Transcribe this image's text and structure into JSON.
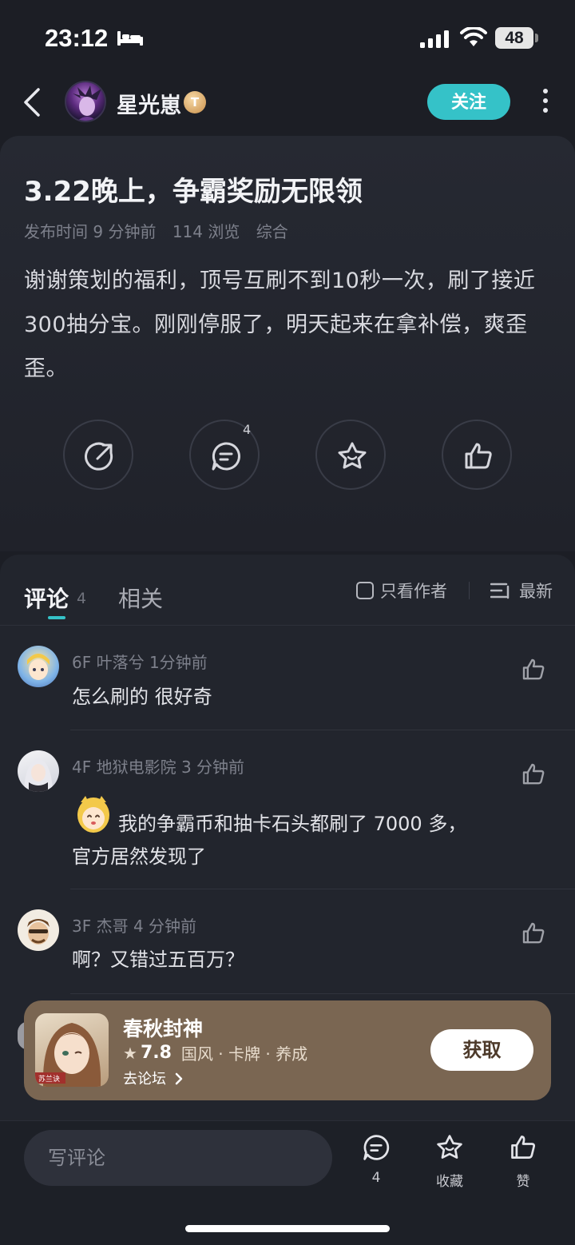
{
  "status_bar": {
    "time": "23:12",
    "battery": "48"
  },
  "header": {
    "author": "星光崽",
    "level_badge": "T",
    "follow_label": "关注"
  },
  "post": {
    "title": "3.22晚上，争霸奖励无限领",
    "meta": {
      "publish": "发布时间 9 分钟前",
      "views": "114 浏览",
      "category": "综合"
    },
    "body": "谢谢策划的福利，顶号互刷不到10秒一次，刷了接近300抽分宝。刚刚停服了，明天起来在拿补偿，爽歪歪。",
    "actions": {
      "comment_count": "4"
    }
  },
  "comments_panel": {
    "tab_comment": "评论",
    "tab_comment_count": "4",
    "tab_related": "相关",
    "only_author": "只看作者",
    "sort": "最新",
    "items": [
      {
        "floor": "6F",
        "user": "叶落兮",
        "time": "1分钟前",
        "text": "怎么刷的 很好奇"
      },
      {
        "floor": "4F",
        "user": "地狱电影院",
        "time": "3 分钟前",
        "text_line1": "我的争霸币和抽卡石头都刷了 7000 多，",
        "text_line2": "官方居然发现了"
      },
      {
        "floor": "3F",
        "user": "杰哥",
        "time": "4 分钟前",
        "text": "啊？又错过五百万？"
      }
    ]
  },
  "game_banner": {
    "name": "春秋封神",
    "score": "7.8",
    "tags": "国风 · 卡牌 · 养成",
    "forum_link": "去论坛",
    "get_label": "获取",
    "icon_caption": "苏兰诀"
  },
  "bottom_bar": {
    "write_placeholder": "写评论",
    "comment_count": "4",
    "collect_label": "收藏",
    "like_label": "赞"
  }
}
